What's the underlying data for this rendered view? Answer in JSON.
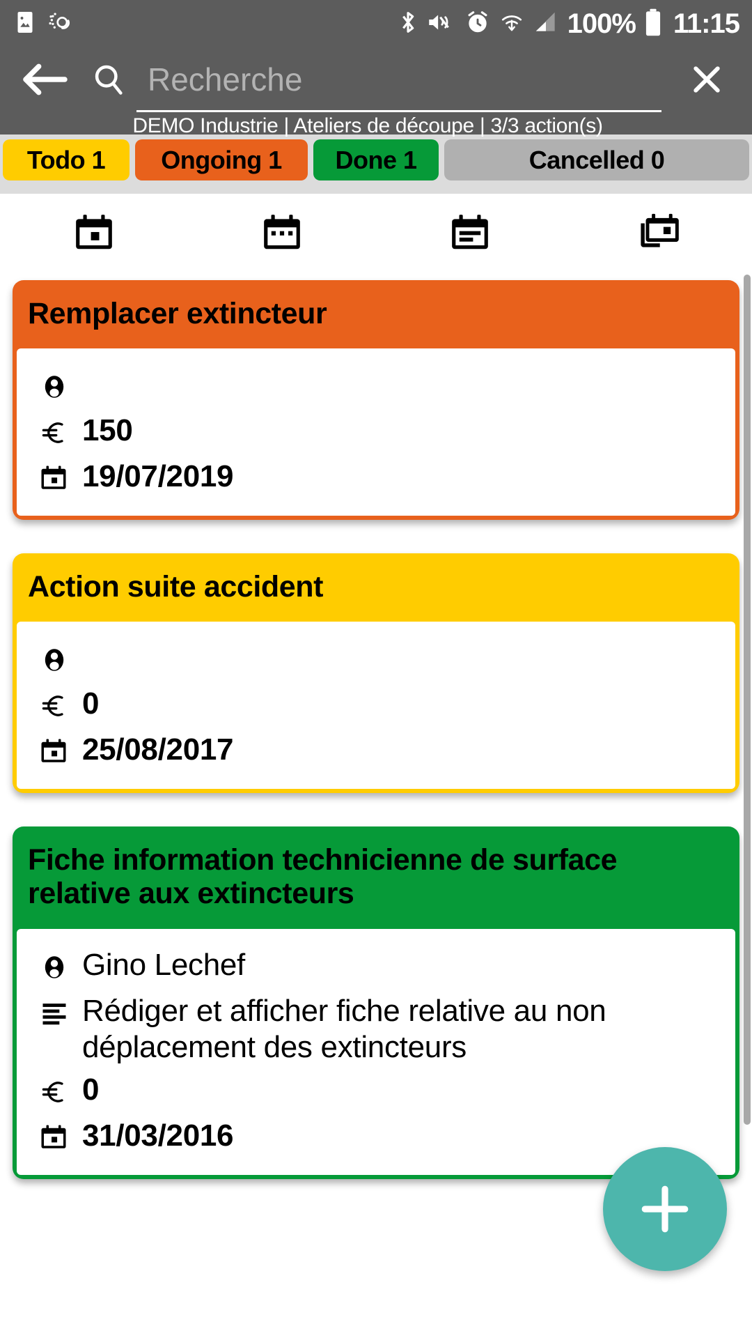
{
  "status_bar": {
    "icons_left": [
      "image-icon",
      "weather-sync-icon"
    ],
    "icons_right": [
      "bluetooth-icon",
      "mute-vibrate-icon",
      "alarm-icon",
      "wifi-icon",
      "signal-icon"
    ],
    "battery": "100%",
    "time": "11:15"
  },
  "appbar": {
    "back_icon": "back-arrow-icon",
    "search_icon": "search-icon",
    "search_value": "",
    "search_placeholder": "Recherche",
    "clear_icon": "close-icon",
    "subtitle": "DEMO Industrie | Ateliers de découpe | 3/3 action(s)"
  },
  "tabs": [
    {
      "label": "Todo 1",
      "color": "#ffcc00",
      "name": "tab-todo"
    },
    {
      "label": "Ongoing 1",
      "color": "#e8611c",
      "name": "tab-ongoing"
    },
    {
      "label": "Done 1",
      "color": "#069a38",
      "name": "tab-done"
    },
    {
      "label": "Cancelled 0",
      "color": "#b0b0b0",
      "name": "tab-cancelled"
    }
  ],
  "view_modes": [
    {
      "name": "calendar-day-view-icon"
    },
    {
      "name": "calendar-week-view-icon"
    },
    {
      "name": "calendar-agenda-view-icon"
    },
    {
      "name": "calendar-multi-view-icon"
    }
  ],
  "cards": [
    {
      "title": "Remplacer extincteur",
      "header_color": "#e8611c",
      "assignee": "",
      "description": "",
      "cost": "150",
      "date": "19/07/2019"
    },
    {
      "title": "Action suite accident",
      "header_color": "#ffcc00",
      "assignee": "",
      "description": "",
      "cost": "0",
      "date": "25/08/2017"
    },
    {
      "title": "Fiche information technicienne de surface relative aux extincteurs",
      "header_color": "#069a38",
      "assignee": "Gino Lechef",
      "description": "Rédiger et afficher fiche relative au non déplacement des extincteurs",
      "cost": "0",
      "date": "31/03/2016"
    }
  ],
  "fab": {
    "icon": "plus-icon",
    "color": "#4db6ac",
    "label": "+"
  },
  "icons": {
    "person": "person-icon",
    "euro": "euro-icon",
    "calendar": "calendar-icon",
    "description": "description-lines-icon"
  }
}
